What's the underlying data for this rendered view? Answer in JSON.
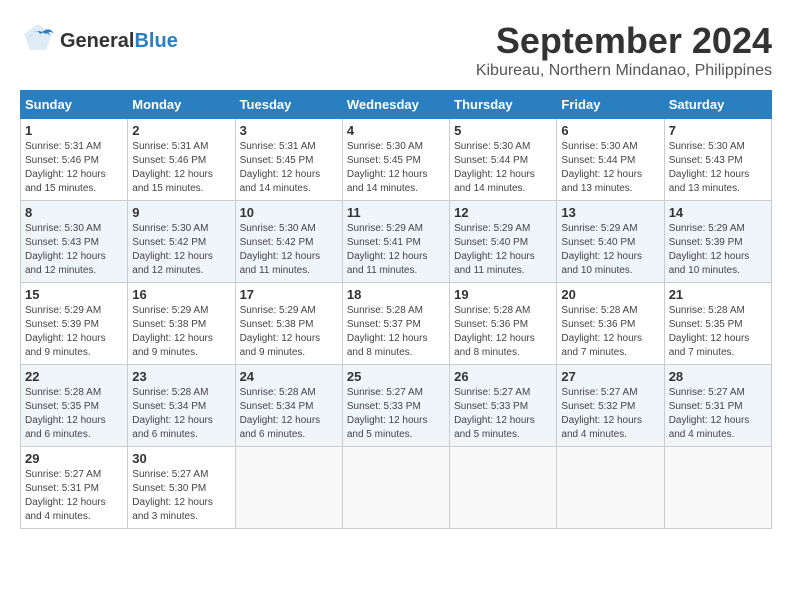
{
  "header": {
    "logo_general": "General",
    "logo_blue": "Blue",
    "month_year": "September 2024",
    "location": "Kibureau, Northern Mindanao, Philippines"
  },
  "weekdays": [
    "Sunday",
    "Monday",
    "Tuesday",
    "Wednesday",
    "Thursday",
    "Friday",
    "Saturday"
  ],
  "weeks": [
    [
      {
        "day": "1",
        "info": "Sunrise: 5:31 AM\nSunset: 5:46 PM\nDaylight: 12 hours\nand 15 minutes."
      },
      {
        "day": "2",
        "info": "Sunrise: 5:31 AM\nSunset: 5:46 PM\nDaylight: 12 hours\nand 15 minutes."
      },
      {
        "day": "3",
        "info": "Sunrise: 5:31 AM\nSunset: 5:45 PM\nDaylight: 12 hours\nand 14 minutes."
      },
      {
        "day": "4",
        "info": "Sunrise: 5:30 AM\nSunset: 5:45 PM\nDaylight: 12 hours\nand 14 minutes."
      },
      {
        "day": "5",
        "info": "Sunrise: 5:30 AM\nSunset: 5:44 PM\nDaylight: 12 hours\nand 14 minutes."
      },
      {
        "day": "6",
        "info": "Sunrise: 5:30 AM\nSunset: 5:44 PM\nDaylight: 12 hours\nand 13 minutes."
      },
      {
        "day": "7",
        "info": "Sunrise: 5:30 AM\nSunset: 5:43 PM\nDaylight: 12 hours\nand 13 minutes."
      }
    ],
    [
      {
        "day": "8",
        "info": "Sunrise: 5:30 AM\nSunset: 5:43 PM\nDaylight: 12 hours\nand 12 minutes."
      },
      {
        "day": "9",
        "info": "Sunrise: 5:30 AM\nSunset: 5:42 PM\nDaylight: 12 hours\nand 12 minutes."
      },
      {
        "day": "10",
        "info": "Sunrise: 5:30 AM\nSunset: 5:42 PM\nDaylight: 12 hours\nand 11 minutes."
      },
      {
        "day": "11",
        "info": "Sunrise: 5:29 AM\nSunset: 5:41 PM\nDaylight: 12 hours\nand 11 minutes."
      },
      {
        "day": "12",
        "info": "Sunrise: 5:29 AM\nSunset: 5:40 PM\nDaylight: 12 hours\nand 11 minutes."
      },
      {
        "day": "13",
        "info": "Sunrise: 5:29 AM\nSunset: 5:40 PM\nDaylight: 12 hours\nand 10 minutes."
      },
      {
        "day": "14",
        "info": "Sunrise: 5:29 AM\nSunset: 5:39 PM\nDaylight: 12 hours\nand 10 minutes."
      }
    ],
    [
      {
        "day": "15",
        "info": "Sunrise: 5:29 AM\nSunset: 5:39 PM\nDaylight: 12 hours\nand 9 minutes."
      },
      {
        "day": "16",
        "info": "Sunrise: 5:29 AM\nSunset: 5:38 PM\nDaylight: 12 hours\nand 9 minutes."
      },
      {
        "day": "17",
        "info": "Sunrise: 5:29 AM\nSunset: 5:38 PM\nDaylight: 12 hours\nand 9 minutes."
      },
      {
        "day": "18",
        "info": "Sunrise: 5:28 AM\nSunset: 5:37 PM\nDaylight: 12 hours\nand 8 minutes."
      },
      {
        "day": "19",
        "info": "Sunrise: 5:28 AM\nSunset: 5:36 PM\nDaylight: 12 hours\nand 8 minutes."
      },
      {
        "day": "20",
        "info": "Sunrise: 5:28 AM\nSunset: 5:36 PM\nDaylight: 12 hours\nand 7 minutes."
      },
      {
        "day": "21",
        "info": "Sunrise: 5:28 AM\nSunset: 5:35 PM\nDaylight: 12 hours\nand 7 minutes."
      }
    ],
    [
      {
        "day": "22",
        "info": "Sunrise: 5:28 AM\nSunset: 5:35 PM\nDaylight: 12 hours\nand 6 minutes."
      },
      {
        "day": "23",
        "info": "Sunrise: 5:28 AM\nSunset: 5:34 PM\nDaylight: 12 hours\nand 6 minutes."
      },
      {
        "day": "24",
        "info": "Sunrise: 5:28 AM\nSunset: 5:34 PM\nDaylight: 12 hours\nand 6 minutes."
      },
      {
        "day": "25",
        "info": "Sunrise: 5:27 AM\nSunset: 5:33 PM\nDaylight: 12 hours\nand 5 minutes."
      },
      {
        "day": "26",
        "info": "Sunrise: 5:27 AM\nSunset: 5:33 PM\nDaylight: 12 hours\nand 5 minutes."
      },
      {
        "day": "27",
        "info": "Sunrise: 5:27 AM\nSunset: 5:32 PM\nDaylight: 12 hours\nand 4 minutes."
      },
      {
        "day": "28",
        "info": "Sunrise: 5:27 AM\nSunset: 5:31 PM\nDaylight: 12 hours\nand 4 minutes."
      }
    ],
    [
      {
        "day": "29",
        "info": "Sunrise: 5:27 AM\nSunset: 5:31 PM\nDaylight: 12 hours\nand 4 minutes."
      },
      {
        "day": "30",
        "info": "Sunrise: 5:27 AM\nSunset: 5:30 PM\nDaylight: 12 hours\nand 3 minutes."
      },
      {
        "day": "",
        "info": ""
      },
      {
        "day": "",
        "info": ""
      },
      {
        "day": "",
        "info": ""
      },
      {
        "day": "",
        "info": ""
      },
      {
        "day": "",
        "info": ""
      }
    ]
  ]
}
